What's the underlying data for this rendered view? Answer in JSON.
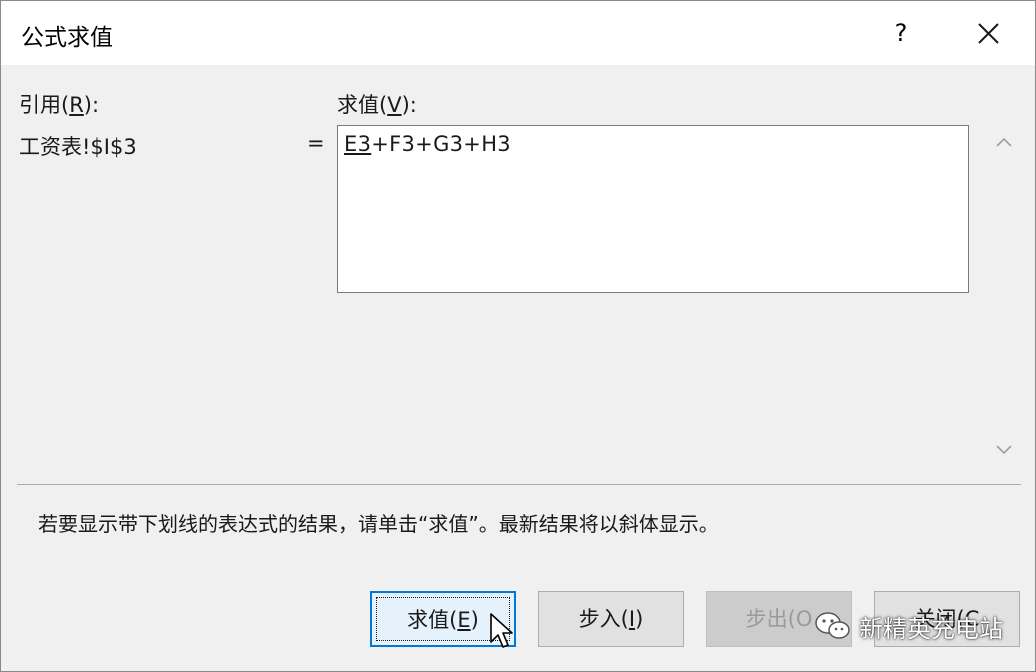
{
  "window": {
    "title": "公式求值",
    "help_label": "?"
  },
  "reference": {
    "label_pre": "引用(",
    "label_key": "R",
    "label_post": "):",
    "value": "工资表!$I$3"
  },
  "evaluation": {
    "label_pre": "求值(",
    "label_key": "V",
    "label_post": "):",
    "equals": "=",
    "underlined_part": "E3",
    "rest": "+F3+G3+H3"
  },
  "hint": "若要显示带下划线的表达式的结果，请单击“求值”。最新结果将以斜体显示。",
  "buttons": {
    "evaluate": {
      "pre": "求值(",
      "key": "E",
      "post": ")"
    },
    "step_in": {
      "pre": "步入(",
      "key": "I",
      "post": ")"
    },
    "step_out": {
      "text": "步出(O"
    },
    "close": {
      "text": "关闭(C"
    }
  },
  "watermark": "新精英充电站",
  "colors": {
    "accent": "#0078d7",
    "dialog_bg": "#f0f0f0",
    "titlebar_bg": "#ffffff"
  }
}
